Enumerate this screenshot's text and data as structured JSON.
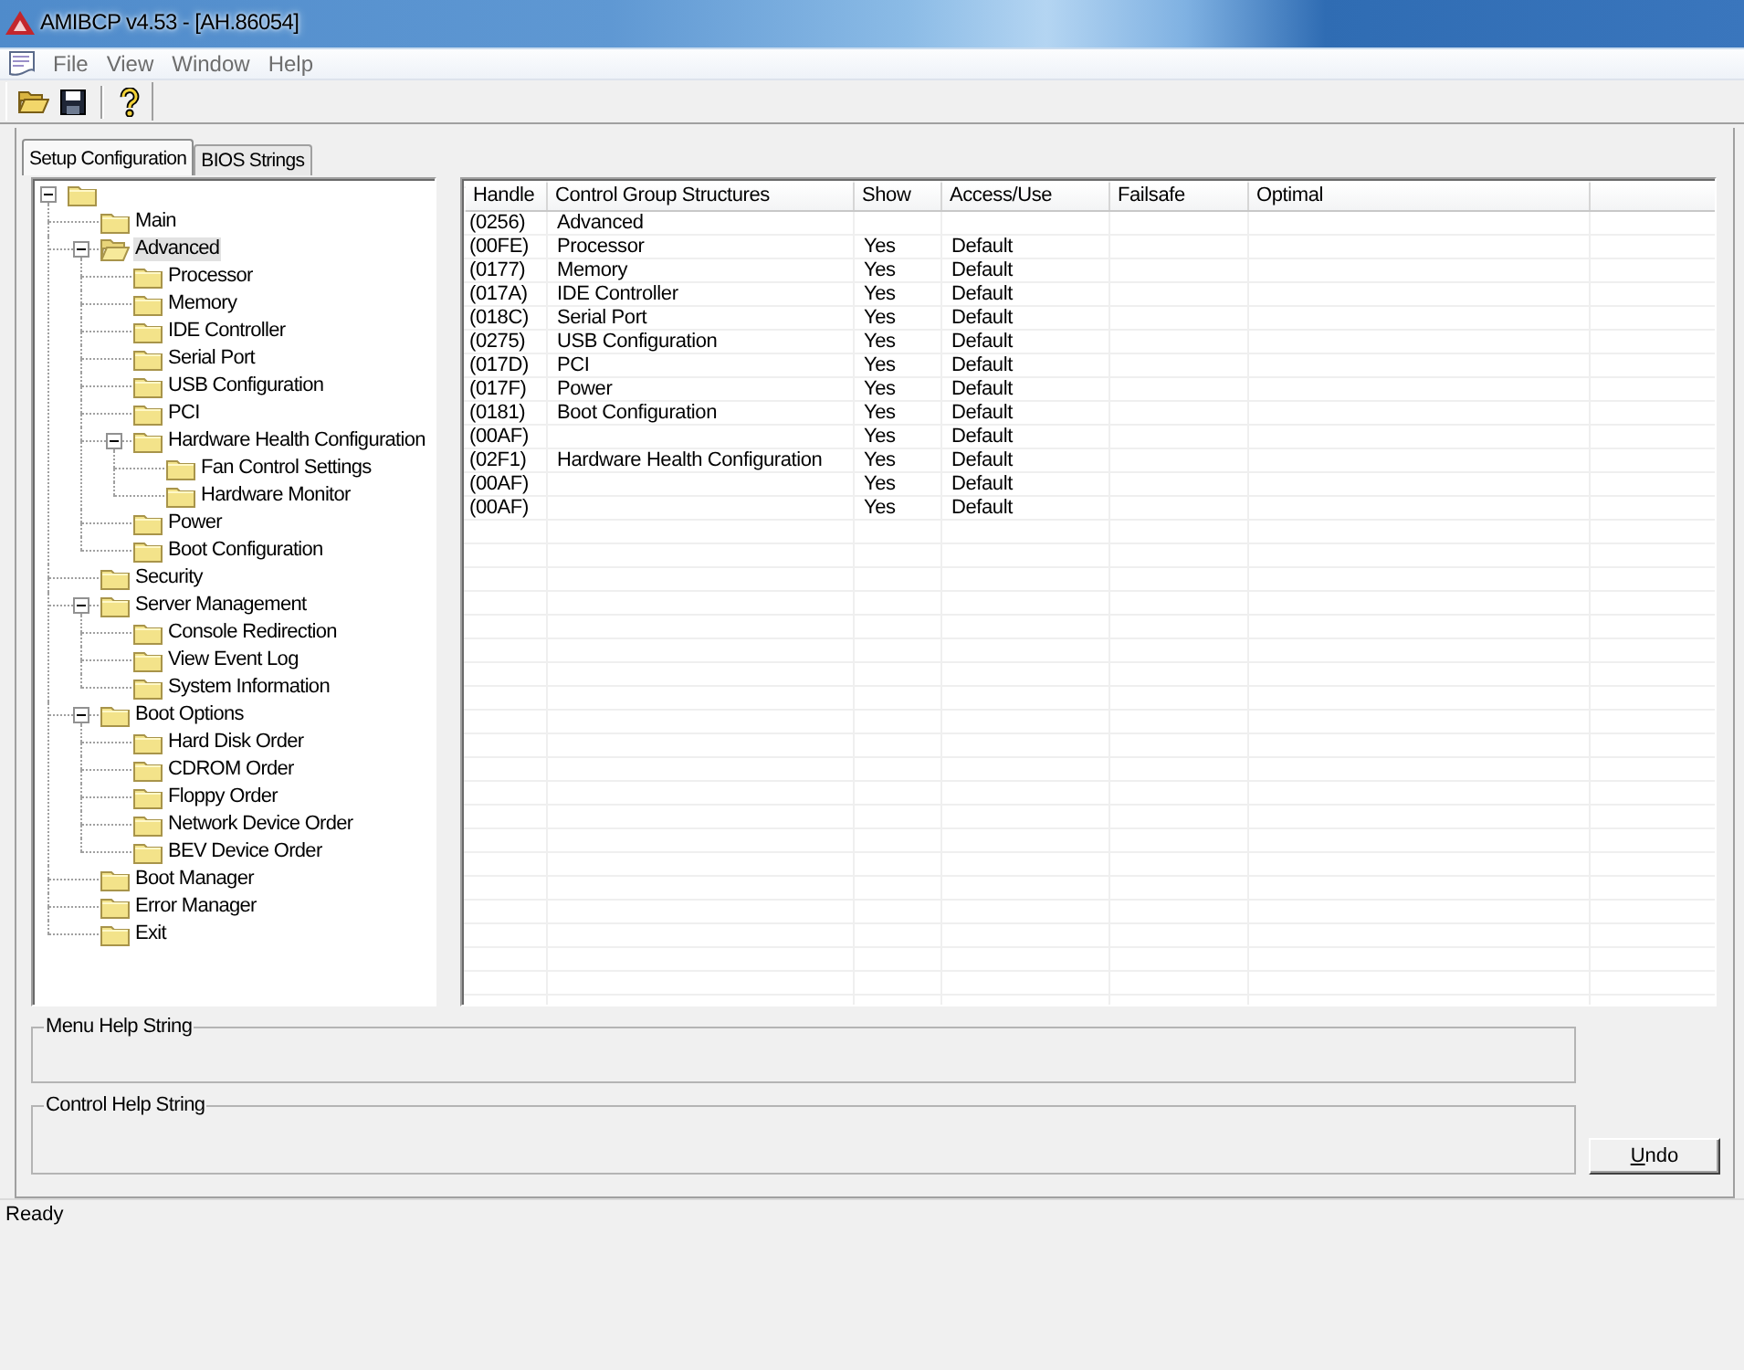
{
  "window": {
    "title": "AMIBCP v4.53 - [AH.86054]"
  },
  "menu": [
    "File",
    "View",
    "Window",
    "Help"
  ],
  "tabs": [
    {
      "label": "Setup Configuration",
      "selected": true
    },
    {
      "label": "BIOS Strings",
      "selected": false
    }
  ],
  "tree": {
    "expanded": true,
    "selected": false,
    "children": [
      {
        "label": "Main",
        "selected": false
      },
      {
        "label": "Advanced",
        "selected": true,
        "expanded": true,
        "children": [
          {
            "label": "Processor",
            "selected": false
          },
          {
            "label": "Memory",
            "selected": false
          },
          {
            "label": "IDE Controller",
            "selected": false
          },
          {
            "label": "Serial Port",
            "selected": false
          },
          {
            "label": "USB Configuration",
            "selected": false
          },
          {
            "label": "PCI",
            "selected": false
          },
          {
            "label": "Hardware Health Configuration",
            "selected": false,
            "expanded": true,
            "children": [
              {
                "label": "Fan Control Settings",
                "selected": false
              },
              {
                "label": "Hardware Monitor",
                "selected": false
              }
            ]
          },
          {
            "label": "Power",
            "selected": false
          },
          {
            "label": "Boot Configuration",
            "selected": false
          }
        ]
      },
      {
        "label": "Security",
        "selected": false
      },
      {
        "label": "Server Management",
        "selected": false,
        "expanded": true,
        "children": [
          {
            "label": "Console Redirection",
            "selected": false
          },
          {
            "label": "View Event Log",
            "selected": false
          },
          {
            "label": "System Information",
            "selected": false
          }
        ]
      },
      {
        "label": "Boot Options",
        "selected": false,
        "expanded": true,
        "children": [
          {
            "label": "Hard Disk Order",
            "selected": false
          },
          {
            "label": "CDROM Order",
            "selected": false
          },
          {
            "label": "Floppy Order",
            "selected": false
          },
          {
            "label": "Network Device Order",
            "selected": false
          },
          {
            "label": "BEV Device Order",
            "selected": false
          }
        ]
      },
      {
        "label": "Boot Manager",
        "selected": false
      },
      {
        "label": "Error Manager",
        "selected": false
      },
      {
        "label": "Exit",
        "selected": false
      }
    ]
  },
  "table": {
    "columns": [
      "Handle",
      "Control Group Structures",
      "Show",
      "Access/Use",
      "Failsafe",
      "Optimal"
    ],
    "rows": [
      {
        "handle": "(0256)",
        "structure": "Advanced"
      },
      {
        "handle": "(00FE)",
        "structure": "Processor",
        "show": "Yes",
        "access_use": "Default"
      },
      {
        "handle": "(0177)",
        "structure": "Memory",
        "show": "Yes",
        "access_use": "Default"
      },
      {
        "handle": "(017A)",
        "structure": "IDE Controller",
        "show": "Yes",
        "access_use": "Default"
      },
      {
        "handle": "(018C)",
        "structure": "Serial Port",
        "show": "Yes",
        "access_use": "Default"
      },
      {
        "handle": "(0275)",
        "structure": "USB Configuration",
        "show": "Yes",
        "access_use": "Default"
      },
      {
        "handle": "(017D)",
        "structure": "PCI",
        "show": "Yes",
        "access_use": "Default"
      },
      {
        "handle": "(017F)",
        "structure": "Power",
        "show": "Yes",
        "access_use": "Default"
      },
      {
        "handle": "(0181)",
        "structure": "Boot Configuration",
        "show": "Yes",
        "access_use": "Default"
      },
      {
        "handle": "(00AF)",
        "show": "Yes",
        "access_use": "Default"
      },
      {
        "handle": "(02F1)",
        "structure": "Hardware Health Configuration",
        "show": "Yes",
        "access_use": "Default"
      },
      {
        "handle": "(00AF)",
        "show": "Yes",
        "access_use": "Default"
      },
      {
        "handle": "(00AF)",
        "show": "Yes",
        "access_use": "Default"
      }
    ]
  },
  "help_groups": [
    "Menu Help String",
    "Control Help String"
  ],
  "buttons": [
    "Undo"
  ],
  "status_bar": {
    "text": "Ready"
  }
}
